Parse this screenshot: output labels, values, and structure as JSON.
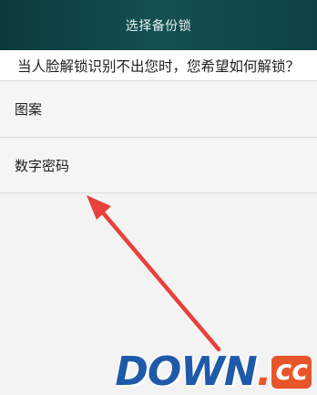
{
  "header": {
    "title": "选择备份锁"
  },
  "prompt": {
    "text": "当人脸解锁识别不出您时，您希望如何解锁？"
  },
  "options": [
    {
      "label": "图案"
    },
    {
      "label": "数字密码"
    }
  ],
  "annotation": {
    "arrow_color": "#e8403c"
  },
  "watermark": {
    "main": "DOWN",
    "dot": ".",
    "tld": "cc"
  }
}
